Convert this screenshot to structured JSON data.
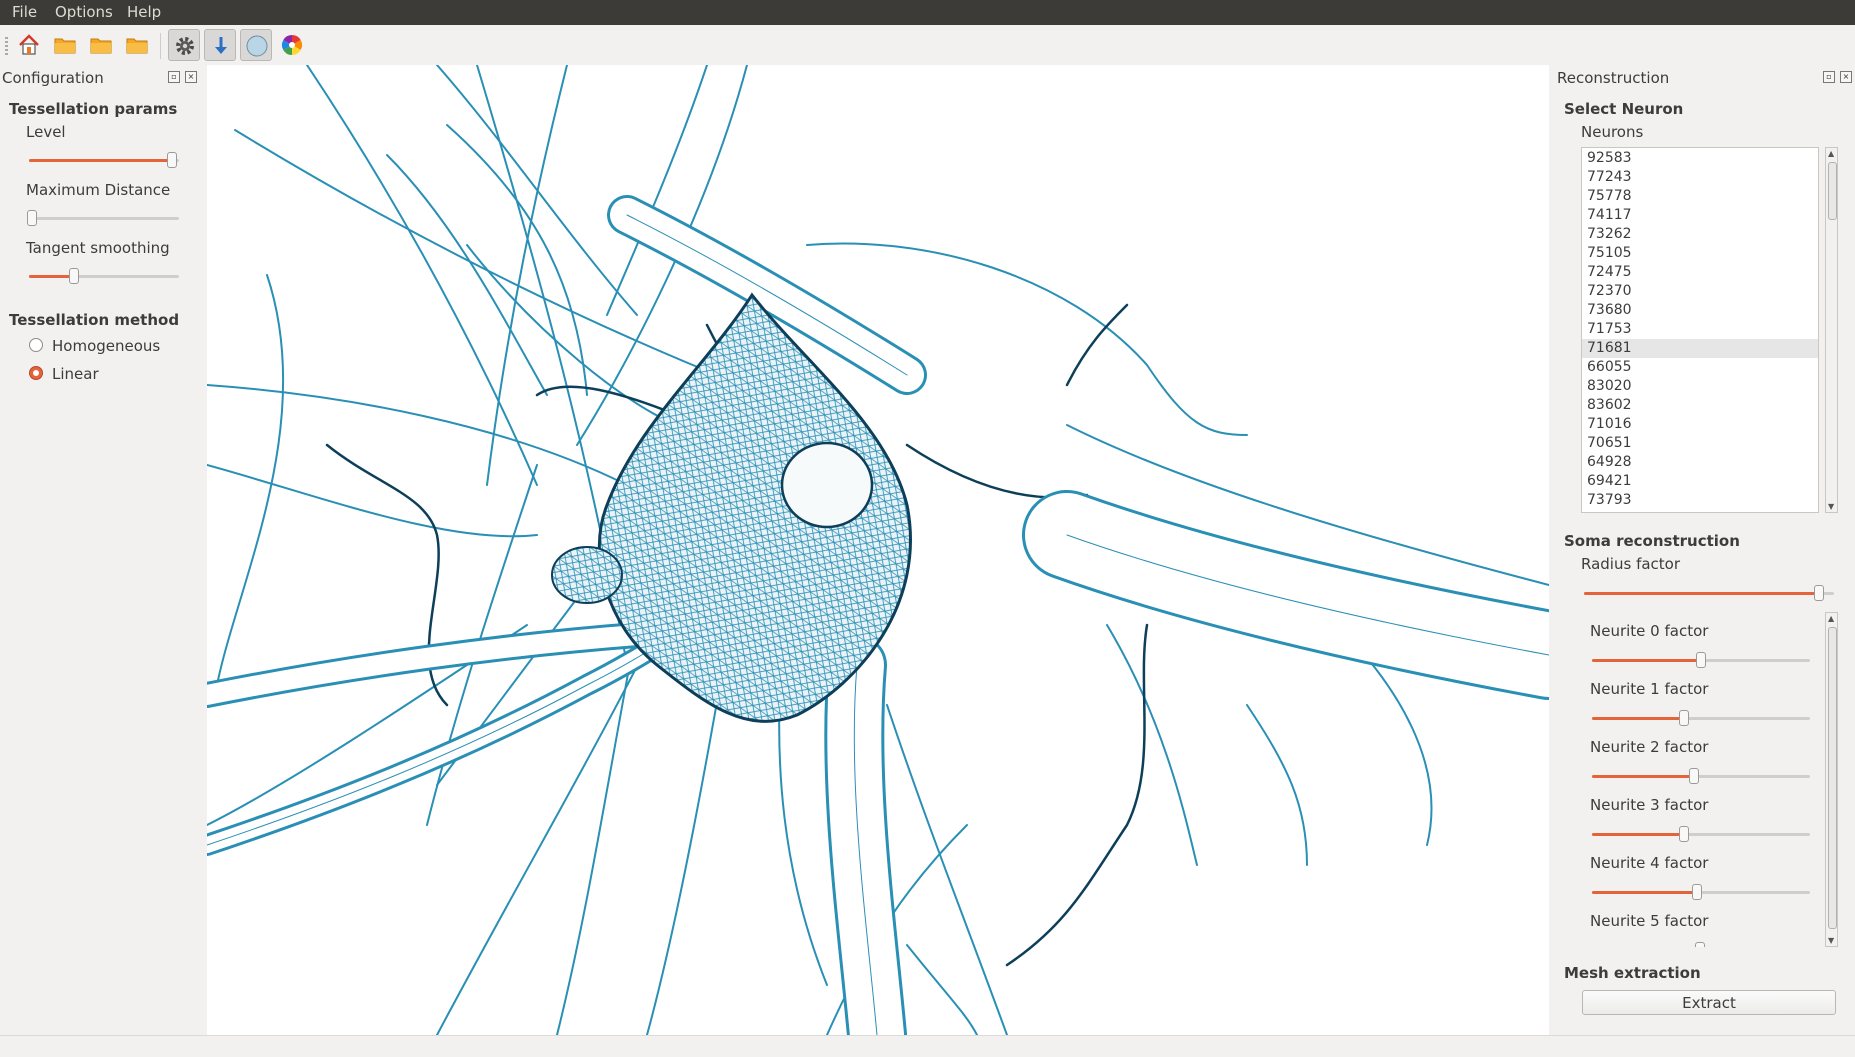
{
  "menu": {
    "file": "File",
    "options": "Options",
    "help": "Help"
  },
  "toolbar": {
    "icons": [
      "home-icon",
      "open-folder-icon",
      "open-folder-icon",
      "open-folder-icon",
      "settings-icon",
      "download-arrow-icon",
      "sphere-icon",
      "color-wheel-icon"
    ]
  },
  "config": {
    "title": "Configuration",
    "tessellation_params": "Tessellation params",
    "level_label": "Level",
    "level_value": 0.95,
    "max_distance_label": "Maximum Distance",
    "max_distance_value": 0.02,
    "tangent_label": "Tangent smoothing",
    "tangent_value": 0.3,
    "method_title": "Tessellation method",
    "method_homogeneous": "Homogeneous",
    "method_linear": "Linear",
    "selected_method": "Linear"
  },
  "recon": {
    "title": "Reconstruction",
    "select_neuron": "Select Neuron",
    "neurons_label": "Neurons",
    "neurons": [
      "92583",
      "77243",
      "75778",
      "74117",
      "73262",
      "75105",
      "72475",
      "72370",
      "73680",
      "71753",
      "71681",
      "66055",
      "83020",
      "83602",
      "71016",
      "70651",
      "64928",
      "69421",
      "73793"
    ],
    "selected_neuron": "71681",
    "soma_title": "Soma reconstruction",
    "radius_label": "Radius factor",
    "radius_value": 0.94,
    "neurite_labels": [
      "Neurite 0 factor",
      "Neurite 1 factor",
      "Neurite 2 factor",
      "Neurite 3 factor",
      "Neurite 4 factor",
      "Neurite 5 factor"
    ],
    "neurite_values": [
      0.5,
      0.42,
      0.47,
      0.42,
      0.48
    ],
    "mesh_title": "Mesh extraction",
    "extract_label": "Extract"
  },
  "colors": {
    "accent": "#e4633a",
    "mesh_light": "#2a8fb5",
    "mesh_dark": "#0d3f5a",
    "menubar": "#3c3b37"
  }
}
